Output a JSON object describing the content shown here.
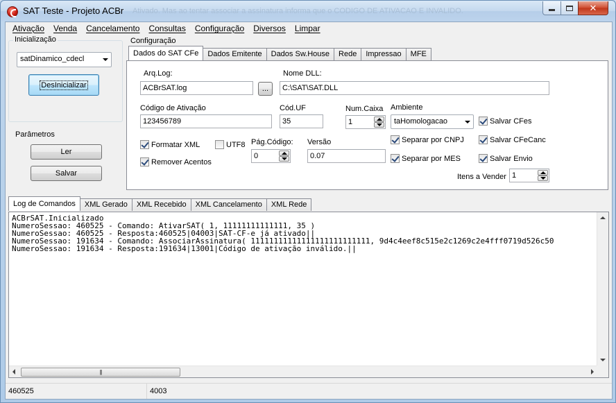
{
  "window": {
    "title": "SAT Teste - Projeto ACBr",
    "background_text": "Ativado. Mas ao tentar associar a assinatura informa que o CODIGO DE ATIVACAO E INVALIDO."
  },
  "menu": [
    "Ativação",
    "Venda",
    "Cancelamento",
    "Consultas",
    "Configuração",
    "Diversos",
    "Limpar"
  ],
  "inicializacao": {
    "group_title": "Inicialização",
    "lib_combo_value": "satDinamico_cdecl",
    "toggle_button": "DesInicializar"
  },
  "parametros": {
    "group_title": "Parâmetros",
    "ler_button": "Ler",
    "salvar_button": "Salvar"
  },
  "configuracao": {
    "label": "Configuração",
    "tabs": [
      "Dados do SAT CFe",
      "Dados Emitente",
      "Dados Sw.House",
      "Rede",
      "Impressao",
      "MFE"
    ],
    "active_tab": 0,
    "fields": {
      "arq_log_label": "Arq.Log:",
      "arq_log_value": "ACBrSAT.log",
      "browse_button": "...",
      "nome_dll_label": "Nome DLL:",
      "nome_dll_value": "C:\\SAT\\SAT.DLL",
      "codigo_ativacao_label": "Código de Ativação",
      "codigo_ativacao_value": "123456789",
      "cod_uf_label": "Cód.UF",
      "cod_uf_value": "35",
      "num_caixa_label": "Num.Caixa",
      "num_caixa_value": "1",
      "ambiente_label": "Ambiente",
      "ambiente_value": "taHomologacao",
      "pag_codigo_label": "Pág.Código:",
      "pag_codigo_value": "0",
      "versao_label": "Versão",
      "versao_value": "0.07",
      "itens_vender_label": "Itens a Vender",
      "itens_vender_value": "1"
    },
    "checkboxes": {
      "formatar_xml": {
        "label": "Formatar XML",
        "checked": true
      },
      "utf8": {
        "label": "UTF8",
        "checked": false
      },
      "remover_acentos": {
        "label": "Remover Acentos",
        "checked": true
      },
      "separar_cnpj": {
        "label": "Separar por CNPJ",
        "checked": true
      },
      "separar_mes": {
        "label": "Separar por MES",
        "checked": true
      },
      "salvar_cfes": {
        "label": "Salvar CFes",
        "checked": true
      },
      "salvar_cfecanc": {
        "label": "Salvar CFeCanc",
        "checked": true
      },
      "salvar_envio": {
        "label": "Salvar Envio",
        "checked": true
      }
    }
  },
  "log": {
    "tabs": [
      "Log de Comandos",
      "XML Gerado",
      "XML Recebido",
      "XML Cancelamento",
      "XML Rede"
    ],
    "active_tab": 0,
    "lines": [
      "ACBrSAT.Inicializado",
      "NumeroSessao: 460525 - Comando: AtivarSAT( 1, 11111111111111, 35 )",
      "NumeroSessao: 460525 - Resposta:460525|04003|SAT-CF-e já ativado||",
      "NumeroSessao: 191634 - Comando: AssociarAssinatura( 11111111111111111111111111, 9d4c4eef8c515e2c1269c2e4fff0719d526c50",
      "NumeroSessao: 191634 - Resposta:191634|13001|Código de ativação inválido.||"
    ]
  },
  "status": {
    "session": "460525",
    "code": "4003"
  }
}
